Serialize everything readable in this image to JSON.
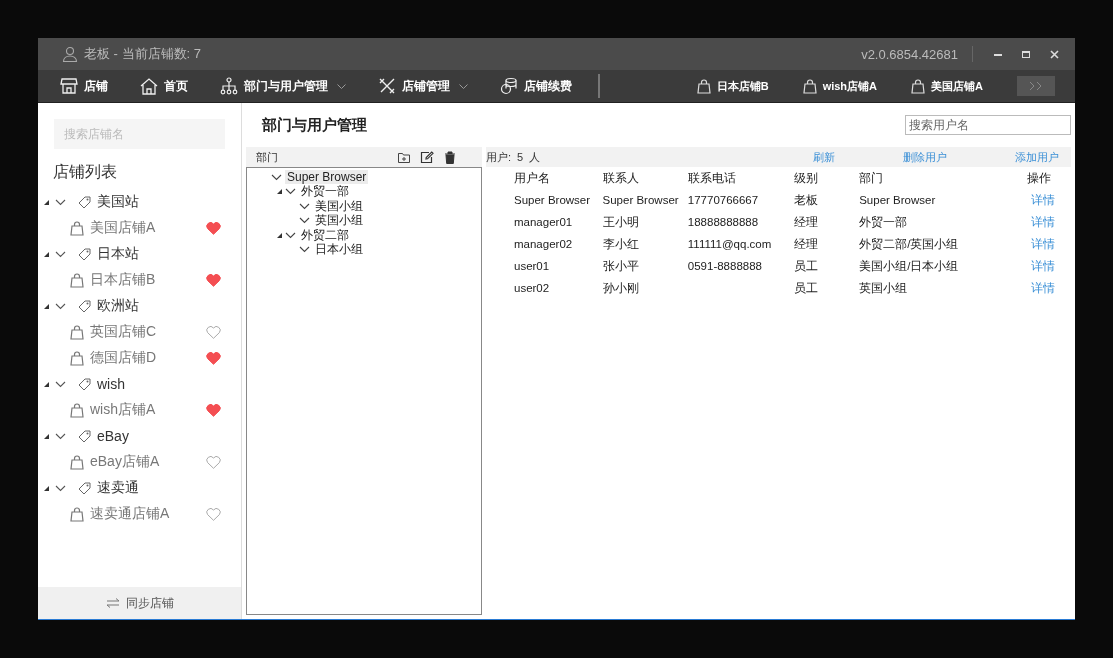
{
  "title_bar": {
    "user": "老板 - 当前店铺数: 7",
    "version": "v2.0.6854.42681"
  },
  "menu": [
    {
      "label": "店铺",
      "kind": "store",
      "dropdown": false
    },
    {
      "label": "首页",
      "kind": "home",
      "dropdown": false
    },
    {
      "label": "部门与用户管理",
      "kind": "org",
      "dropdown": true
    },
    {
      "label": "店铺管理",
      "kind": "tools",
      "dropdown": true
    },
    {
      "label": "店铺续费",
      "kind": "coins",
      "dropdown": false
    }
  ],
  "open_shops": [
    "日本店铺B",
    "wish店铺A",
    "美国店铺A"
  ],
  "sidebar": {
    "search_placeholder": "搜索店铺名",
    "list_title": "店铺列表",
    "groups": [
      {
        "name": "美国站",
        "shops": [
          {
            "name": "美国店铺A",
            "favorite": true
          }
        ]
      },
      {
        "name": "日本站",
        "shops": [
          {
            "name": "日本店铺B",
            "favorite": true
          }
        ]
      },
      {
        "name": "欧洲站",
        "shops": [
          {
            "name": "英国店铺C",
            "favorite": false
          },
          {
            "name": "德国店铺D",
            "favorite": true
          }
        ]
      },
      {
        "name": "wish",
        "shops": [
          {
            "name": "wish店铺A",
            "favorite": true
          }
        ]
      },
      {
        "name": "eBay",
        "shops": [
          {
            "name": "eBay店铺A",
            "favorite": false
          }
        ]
      },
      {
        "name": "速卖通",
        "shops": [
          {
            "name": "速卖通店铺A",
            "favorite": false
          }
        ]
      }
    ],
    "sync_button": "同步店铺"
  },
  "page_title": "部门与用户管理",
  "user_search": {
    "placeholder": "搜索用户名"
  },
  "dept_panel": {
    "title": "部门",
    "tree": [
      {
        "label": "Super Browser",
        "selected": true,
        "children": [
          {
            "label": "外贸一部",
            "selected": false,
            "children": [
              {
                "label": "美国小组",
                "selected": false
              },
              {
                "label": "英国小组",
                "selected": false
              }
            ]
          },
          {
            "label": "外贸二部",
            "selected": false,
            "children": [
              {
                "label": "日本小组",
                "selected": false
              }
            ]
          }
        ]
      }
    ]
  },
  "users": {
    "count_label": "用户:",
    "count": "5",
    "unit": "人",
    "actions": [
      "刷新",
      "删除用户",
      "添加用户"
    ],
    "columns": [
      "用户名",
      "联系人",
      "联系电话",
      "级别",
      "部门",
      "操作"
    ],
    "rows": [
      [
        "Super Browser",
        "Super Browser",
        "17770766667",
        "老板",
        "Super Browser",
        "详情"
      ],
      [
        "manager01",
        "王小明",
        "18888888888",
        "经理",
        "外贸一部",
        "详情"
      ],
      [
        "manager02",
        "李小红",
        "111111@qq.com",
        "经理",
        "外贸二部/英国小组",
        "详情"
      ],
      [
        "user01",
        "张小平",
        "0591-8888888",
        "员工",
        "美国小组/日本小组",
        "详情"
      ],
      [
        "user02",
        "孙小刚",
        "",
        "员工",
        "英国小组",
        "详情"
      ]
    ]
  }
}
